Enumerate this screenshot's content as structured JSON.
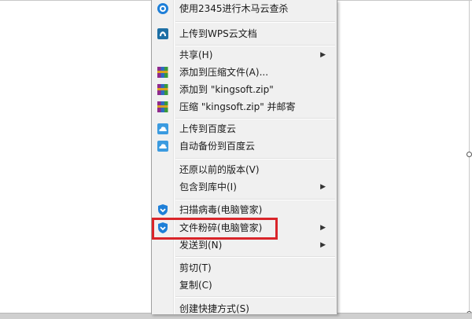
{
  "menu": {
    "items": [
      {
        "label": "使用2345进行木马云查杀",
        "icon": "shield-round-icon",
        "arrow": ""
      },
      {
        "label": "上传到WPS云文档",
        "icon": "wps-cloud-icon",
        "arrow": ""
      },
      {
        "label": "共享(H)",
        "icon": "",
        "arrow": "▶"
      },
      {
        "label": "添加到压缩文件(A)...",
        "icon": "archive-icon",
        "arrow": ""
      },
      {
        "label": "添加到 \"kingsoft.zip\"",
        "icon": "archive-icon",
        "arrow": ""
      },
      {
        "label": "压缩 \"kingsoft.zip\" 并邮寄",
        "icon": "archive-icon",
        "arrow": ""
      },
      {
        "label": "上传到百度云",
        "icon": "baidu-cloud-icon",
        "arrow": ""
      },
      {
        "label": "自动备份到百度云",
        "icon": "baidu-cloud-icon",
        "arrow": ""
      },
      {
        "label": "还原以前的版本(V)",
        "icon": "",
        "arrow": ""
      },
      {
        "label": "包含到库中(I)",
        "icon": "",
        "arrow": "▶"
      },
      {
        "label": "扫描病毒(电脑管家)",
        "icon": "tencent-shield-icon",
        "arrow": ""
      },
      {
        "label": "文件粉碎(电脑管家)",
        "icon": "tencent-shield-icon",
        "arrow": "▶"
      },
      {
        "label": "发送到(N)",
        "icon": "",
        "arrow": "▶"
      },
      {
        "label": "剪切(T)",
        "icon": "",
        "arrow": ""
      },
      {
        "label": "复制(C)",
        "icon": "",
        "arrow": ""
      },
      {
        "label": "创建快捷方式(S)",
        "icon": "",
        "arrow": ""
      }
    ]
  },
  "colors": {
    "highlight": "#d9252a",
    "menu_background": "#f0f0f0",
    "shield_blue": "#1e7fd8"
  }
}
